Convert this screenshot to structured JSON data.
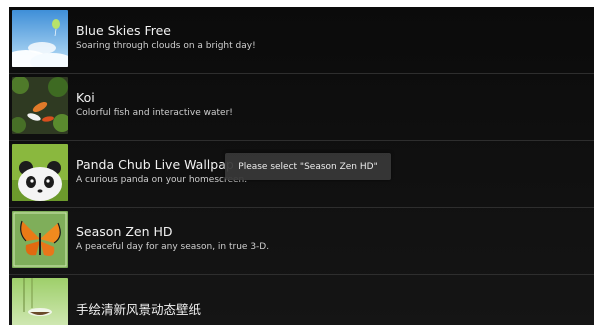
{
  "wallpapers": [
    {
      "title": "Blue Skies Free",
      "subtitle": "Soaring through clouds on a bright day!",
      "icon": "sky-clouds-icon"
    },
    {
      "title": "Koi",
      "subtitle": "Colorful fish and interactive water!",
      "icon": "koi-pond-icon"
    },
    {
      "title": "Panda Chub Live Wallpap",
      "subtitle": "A curious panda on your homescreen.",
      "icon": "panda-icon"
    },
    {
      "title": "Season Zen HD",
      "subtitle": "A peaceful day for any season, in true 3-D.",
      "icon": "butterfly-icon"
    },
    {
      "title": "手绘清新风景动态壁纸",
      "subtitle": "",
      "icon": "landscape-boat-icon"
    }
  ],
  "toast": {
    "text": "Please select \"Season Zen HD\""
  },
  "colors": {
    "background": "#0b0b0b",
    "divider": "#2e2e2e",
    "toast": "#373737"
  }
}
